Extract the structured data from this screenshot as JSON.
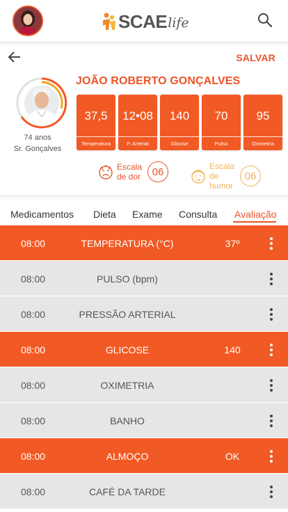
{
  "header": {
    "logo_text": "SCAE",
    "logo_suffix": "life",
    "avatar_icon": "user-avatar",
    "search_icon": "search-icon"
  },
  "actions": {
    "back_icon": "arrow-left-icon",
    "save_label": "SALVAR"
  },
  "patient": {
    "name": "JOÃO ROBERTO GONÇALVES",
    "age": "74 anos",
    "nickname": "Sr. Gonçalves"
  },
  "vitals": [
    {
      "value": "37,5",
      "label": "Temperatura"
    },
    {
      "value": "12•08",
      "label": "P. Arterial"
    },
    {
      "value": "140",
      "label": "Glicose"
    },
    {
      "value": "70",
      "label": "Pulso"
    },
    {
      "value": "95",
      "label": "Oximetria"
    }
  ],
  "scales": {
    "pain": {
      "line1": "Escala",
      "line2": "de dor",
      "value": "06",
      "icon": "pain-face-icon"
    },
    "mood": {
      "line1": "Escala",
      "line2": "de humor",
      "value": "06",
      "icon": "mood-face-icon"
    }
  },
  "tabs": [
    {
      "label": "Medicamentos",
      "active": false
    },
    {
      "label": "Dieta",
      "active": false
    },
    {
      "label": "Exame",
      "active": false
    },
    {
      "label": "Consulta",
      "active": false
    },
    {
      "label": "Avaliação",
      "active": true
    }
  ],
  "rows": [
    {
      "time": "08:00",
      "name": "TEMPERATURA (°C)",
      "value": "37º",
      "highlight": true
    },
    {
      "time": "08:00",
      "name": "PULSO (bpm)",
      "value": "",
      "highlight": false
    },
    {
      "time": "08:00",
      "name": "PRESSÃO ARTERIAL",
      "value": "",
      "highlight": false
    },
    {
      "time": "08:00",
      "name": "GLICOSE",
      "value": "140",
      "highlight": true
    },
    {
      "time": "08:00",
      "name": "OXIMETRIA",
      "value": "",
      "highlight": false
    },
    {
      "time": "08:00",
      "name": "BANHO",
      "value": "",
      "highlight": false
    },
    {
      "time": "08:00",
      "name": "ALMOÇO",
      "value": "OK",
      "highlight": true
    },
    {
      "time": "08:00",
      "name": "CAFÉ DA TARDE",
      "value": "",
      "highlight": false
    }
  ],
  "colors": {
    "accent": "#e8542a",
    "row_highlight": "#f15a24",
    "row_default": "#e6e6e6",
    "mood": "#f0b35a"
  }
}
